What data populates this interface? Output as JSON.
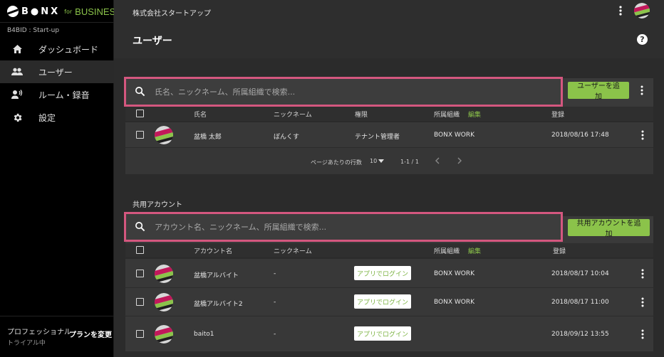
{
  "sidebar": {
    "logo_text": "B●NX",
    "logo_for": "for",
    "logo_business": "BUSINESS",
    "org_id": "B4BID : Start-up",
    "items": [
      {
        "label": "ダッシュボード",
        "icon": "home-icon"
      },
      {
        "label": "ユーザー",
        "icon": "people-icon"
      },
      {
        "label": "ルーム・録音",
        "icon": "speaker-person-icon"
      },
      {
        "label": "設定",
        "icon": "gear-icon"
      }
    ],
    "plan_name": "プロフェッショナル",
    "plan_sub": "トライアル中",
    "plan_change": "プランを変更"
  },
  "header": {
    "company": "株式会社スタートアップ",
    "title": "ユーザー",
    "help": "?"
  },
  "users": {
    "search_placeholder": "氏名、ニックネーム、所属組織で検索...",
    "add_button": "ユーザーを追加",
    "columns": {
      "name": "氏名",
      "nickname": "ニックネーム",
      "role": "権限",
      "org": "所属組織",
      "edit": "編集",
      "registered": "登録"
    },
    "rows": [
      {
        "name": "盆橋 太郎",
        "nickname": "ぼんくす",
        "role": "テナント管理者",
        "org": "BONX WORK",
        "registered": "2018/08/16 17:48"
      }
    ],
    "pager": {
      "rows_per_page_label": "ページあたりの行数",
      "rows_per_page": "10",
      "range": "1-1 / 1"
    }
  },
  "shared": {
    "section_title": "共用アカウント",
    "search_placeholder": "アカウント名、ニックネーム、所属組織で検索...",
    "add_button": "共用アカウントを追加",
    "columns": {
      "name": "アカウント名",
      "nickname": "ニックネーム",
      "org": "所属組織",
      "edit": "編集",
      "registered": "登録"
    },
    "login_label": "アプリでログイン",
    "rows": [
      {
        "name": "盆橋アルバイト",
        "nickname": "-",
        "org": "BONX WORK",
        "registered": "2018/08/17 10:04"
      },
      {
        "name": "盆橋アルバイト2",
        "nickname": "-",
        "org": "BONX WORK",
        "registered": "2018/08/17 11:00"
      },
      {
        "name": "baito1",
        "nickname": "-",
        "org": "",
        "registered": "2018/09/12 13:55"
      }
    ]
  },
  "colors": {
    "accent": "#8bc34a",
    "highlight": "#d4577f",
    "sidebar_bg": "#000000"
  }
}
